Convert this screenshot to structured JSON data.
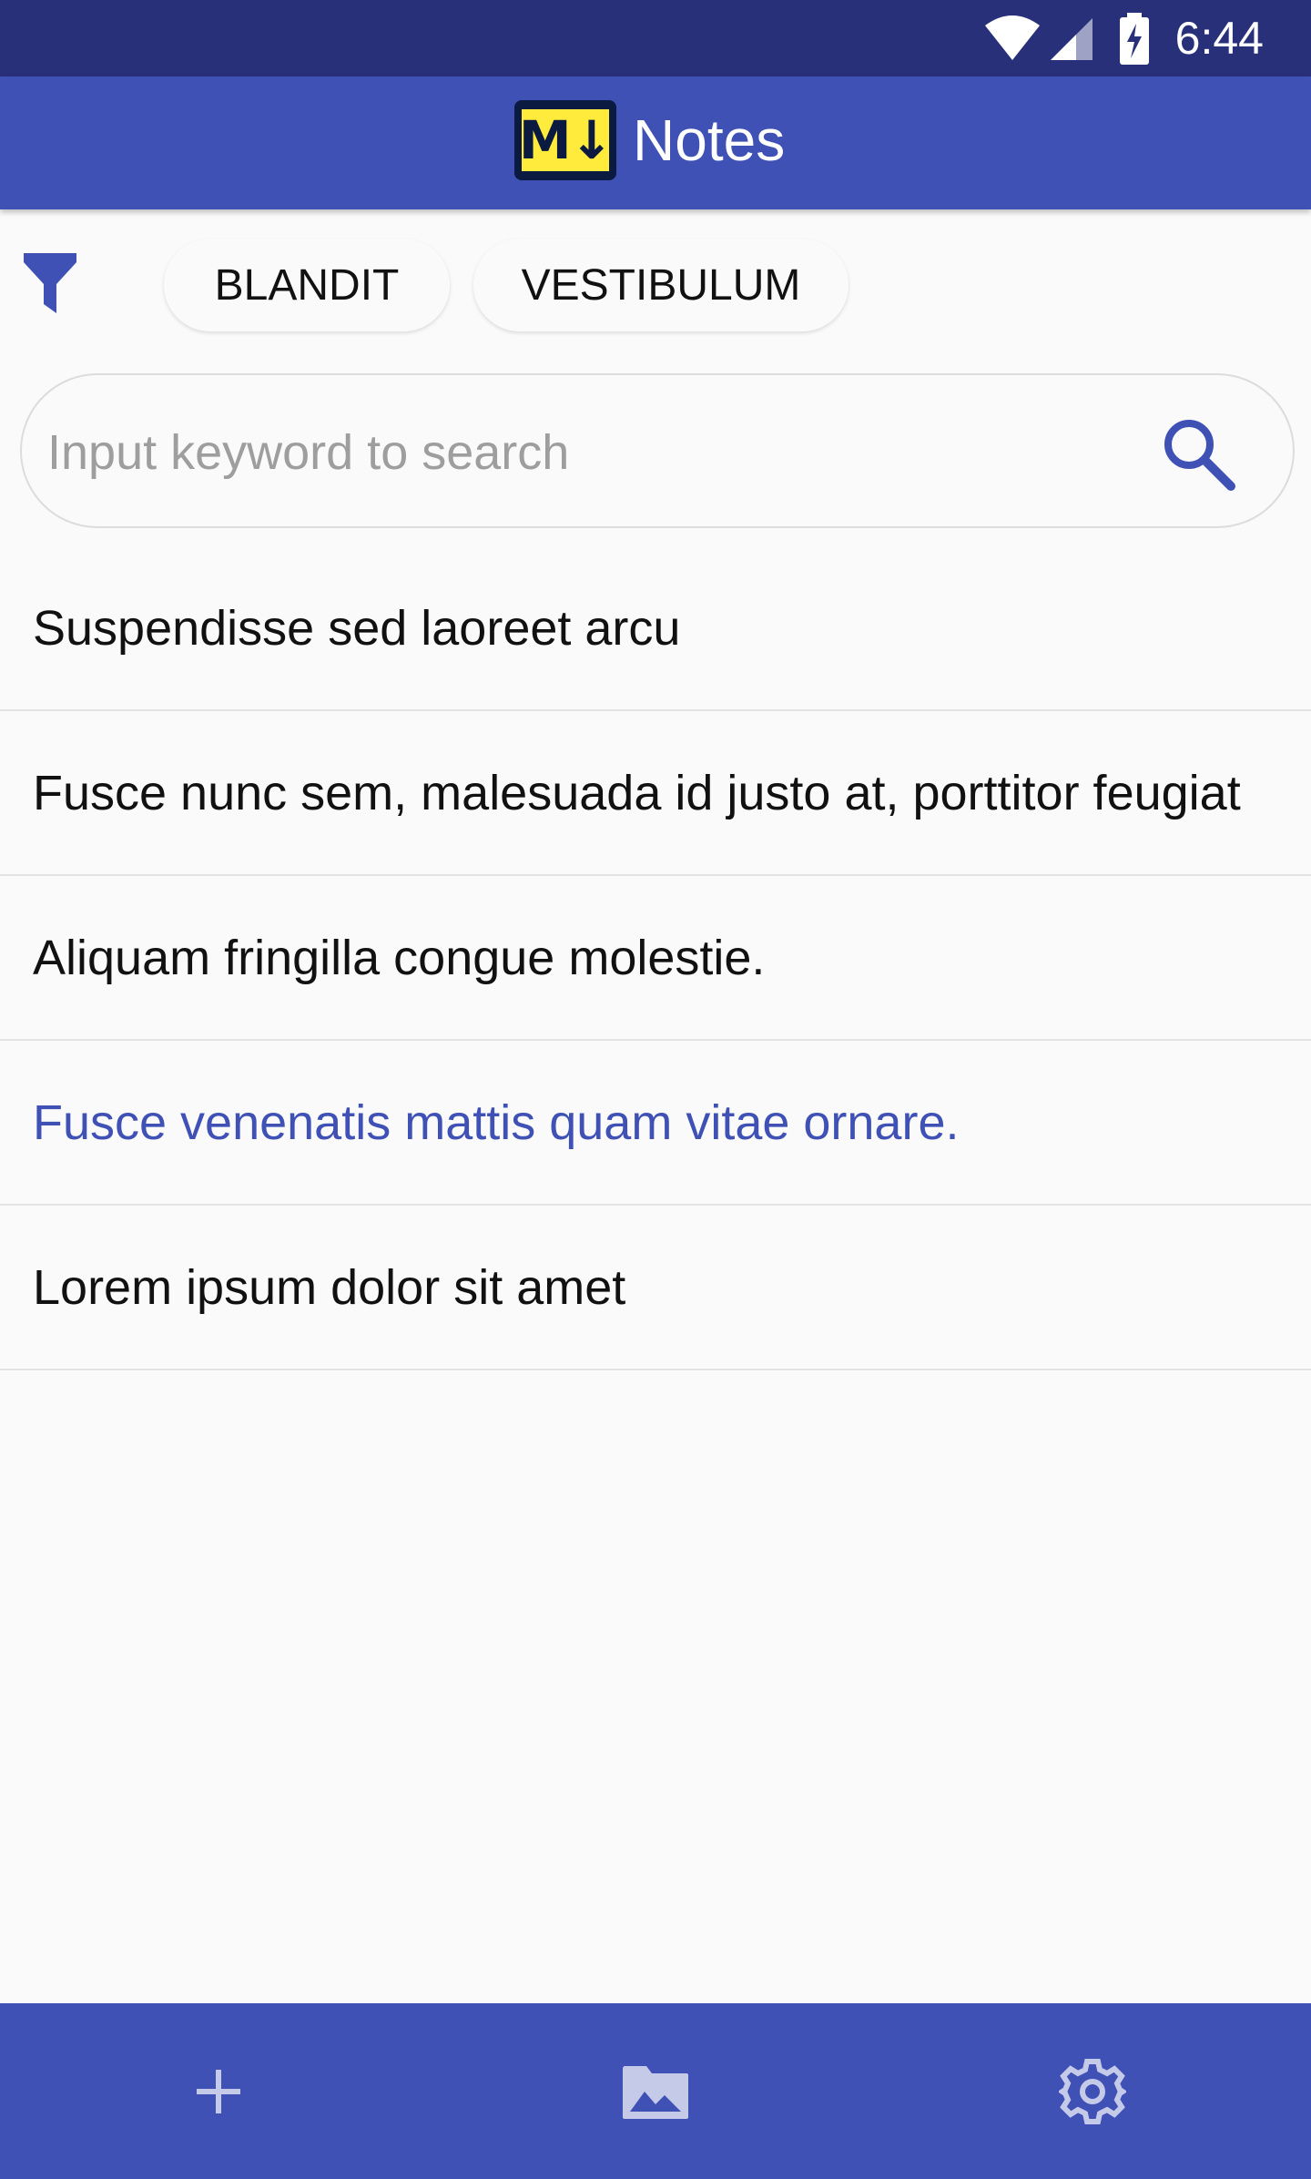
{
  "status_bar": {
    "time": "6:44",
    "icons": [
      "wifi-icon",
      "cellular-signal-icon",
      "battery-charging-icon"
    ]
  },
  "app_bar": {
    "logo_text": "M↓",
    "title": "Notes"
  },
  "filter": {
    "icon": "filter-icon",
    "chips": [
      "BLANDIT",
      "VESTIBULUM"
    ]
  },
  "search": {
    "placeholder": "Input keyword to search",
    "value": "",
    "icon": "search-icon"
  },
  "notes": [
    "Suspendisse sed laoreet arcu",
    "Fusce nunc sem, malesuada id justo at, porttitor feugiat",
    "Aliquam fringilla congue molestie.",
    "Fusce venenatis mattis quam vitae ornare.",
    "Lorem ipsum dolor sit amet"
  ],
  "selected_note_index": 3,
  "bottom_bar": {
    "buttons": [
      "add-icon",
      "image-folder-icon",
      "settings-icon"
    ]
  },
  "colors": {
    "primary": "#3f51b5",
    "status_bar": "#28307a",
    "logo_yellow": "#ffeb3b",
    "selected_text": "#3f51b5"
  }
}
